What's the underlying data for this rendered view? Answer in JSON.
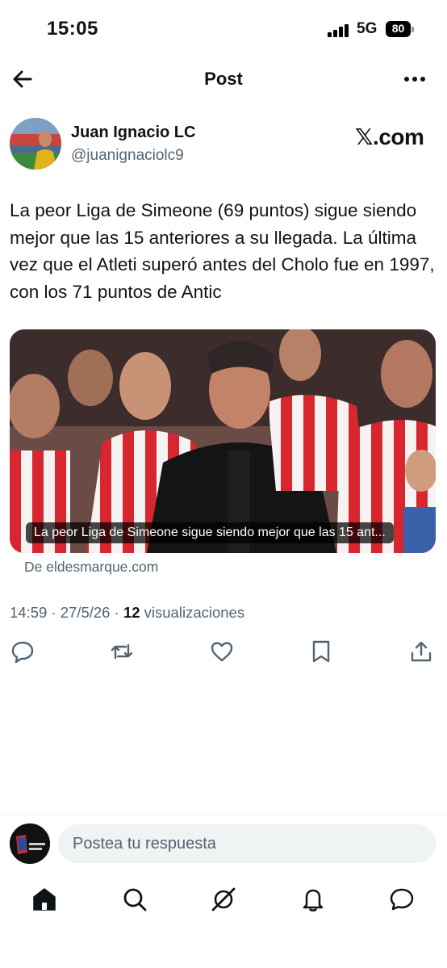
{
  "status_bar": {
    "time": "15:05",
    "network": "5G",
    "battery": "80"
  },
  "header": {
    "title": "Post"
  },
  "author": {
    "name": "Juan Ignacio LC",
    "handle": "@juanignaciolc9"
  },
  "source_site": "𝕏.com",
  "tweet": {
    "text": "La peor Liga de Simeone (69 puntos) sigue siendo mejor que las 15 anteriores a su llegada. La última vez que el Atleti superó antes del Cholo fue en 1997, con los 71 puntos de Antic"
  },
  "link_card": {
    "caption": "La peor Liga de Simeone sigue siendo mejor que las 15 ant...",
    "source": "De eldesmarque.com"
  },
  "meta": {
    "time": "14:59",
    "date": "27/5/26",
    "views_count": "12",
    "views_label": "visualizaciones"
  },
  "reply": {
    "placeholder": "Postea tu respuesta"
  },
  "icons": {
    "back": "arrow-left-icon",
    "more": "more-icon",
    "actions": [
      "reply-icon",
      "repost-icon",
      "like-icon",
      "bookmark-icon",
      "share-icon"
    ],
    "nav": [
      "home-icon",
      "search-icon",
      "grok-icon",
      "notifications-icon",
      "messages-icon"
    ]
  },
  "colors": {
    "text": "#0f1419",
    "secondary": "#536471",
    "field": "#eff3f4"
  }
}
